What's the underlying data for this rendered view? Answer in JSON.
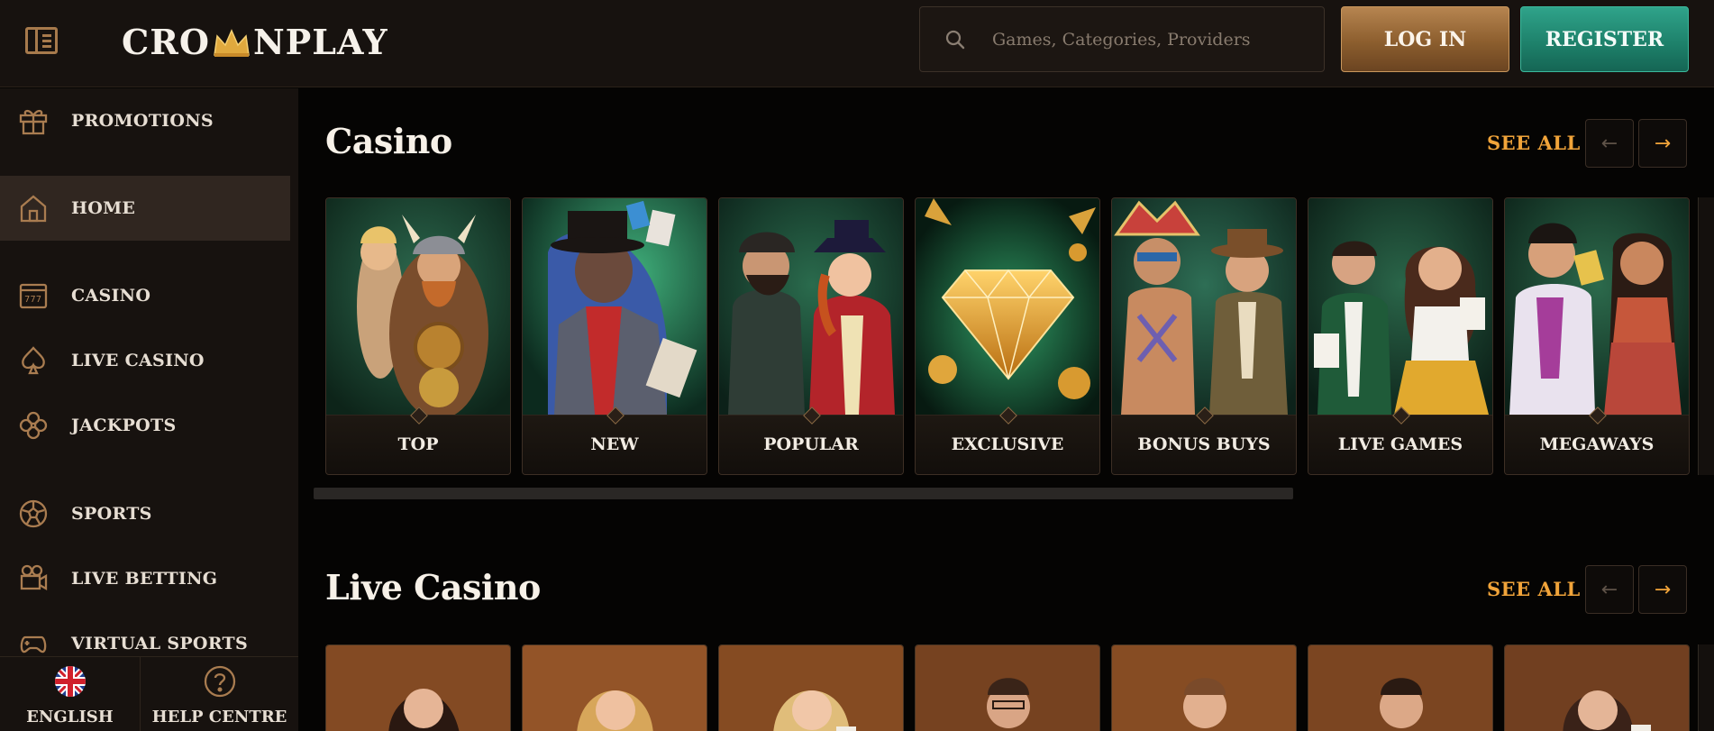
{
  "header": {
    "logo_text_left": "CRO",
    "logo_text_right": "NPLAY",
    "search_placeholder": "Games, Categories, Providers",
    "login_label": "LOG IN",
    "register_label": "REGISTER"
  },
  "sidebar": {
    "items": [
      {
        "label": "PROMOTIONS",
        "icon": "gift-icon"
      },
      {
        "label": "HOME",
        "icon": "home-icon"
      },
      {
        "label": "CASINO",
        "icon": "slot-machine-icon"
      },
      {
        "label": "LIVE CASINO",
        "icon": "spade-icon"
      },
      {
        "label": "JACKPOTS",
        "icon": "clover-icon"
      },
      {
        "label": "SPORTS",
        "icon": "football-icon"
      },
      {
        "label": "LIVE BETTING",
        "icon": "tv-camera-icon"
      },
      {
        "label": "VIRTUAL SPORTS",
        "icon": "gamepad-icon"
      }
    ],
    "footer": {
      "language_label": "ENGLISH",
      "help_label": "HELP CENTRE"
    }
  },
  "casino": {
    "title": "Casino",
    "see_all": "SEE ALL",
    "cards": [
      "TOP",
      "NEW",
      "POPULAR",
      "EXCLUSIVE",
      "BONUS BUYS",
      "LIVE GAMES",
      "MEGAWAYS"
    ]
  },
  "live_casino": {
    "title": "Live Casino",
    "see_all": "SEE ALL"
  },
  "colors": {
    "accent_gold": "#f1a43a",
    "login_bronze": "#9a6a38",
    "register_teal": "#249078",
    "sidebar_bg": "#17120f",
    "page_bg": "#050403"
  }
}
